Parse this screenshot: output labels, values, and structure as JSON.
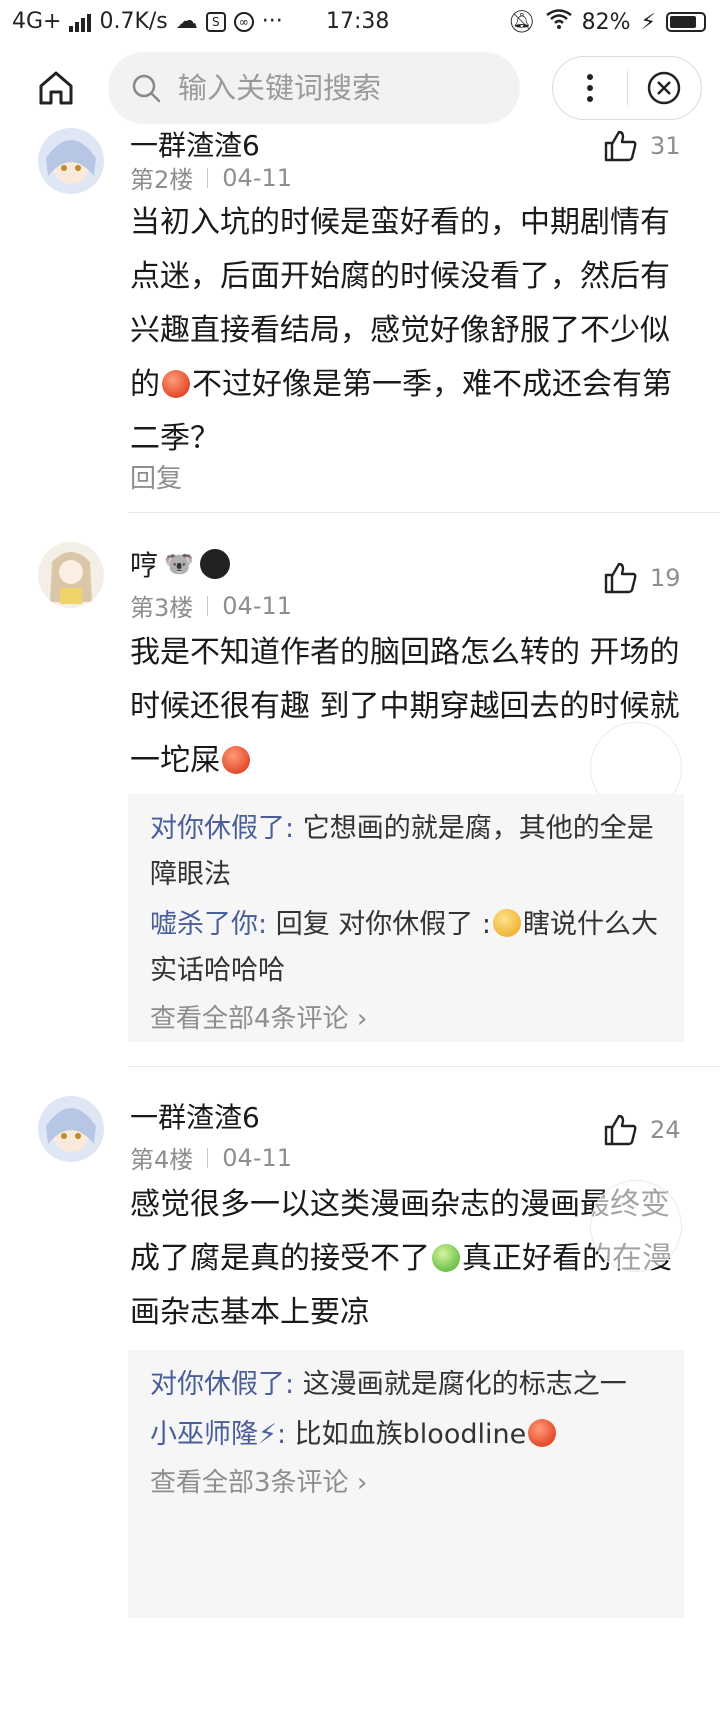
{
  "status_bar": {
    "network": "4G+",
    "speed": "0.7K/s",
    "time": "17:38",
    "more": "···",
    "battery": "82%",
    "battery_level": 0.82
  },
  "toolbar": {
    "search_placeholder": "输入关键词搜索"
  },
  "comments": [
    {
      "user": "一群渣渣6",
      "floor": "第2楼",
      "date": "04-11",
      "likes": "31",
      "text_a": "当初入坑的时候是蛮好看的，中期剧情有点迷，后面开始腐的时候没看了，然后有兴趣直接看结局，感觉好像舒服了不少似的",
      "text_b": "不过好像是第一季，难不成还会有第二季？",
      "reply_label": "回复"
    },
    {
      "user": "哼",
      "floor": "第3楼",
      "date": "04-11",
      "likes": "19",
      "text_a": "我是不知道作者的脑回路怎么转的 开场的时候还很有趣 到了中期穿越回去的时候就一坨屎",
      "replies": [
        {
          "who": "对你休假了:",
          "text": "它想画的就是腐，其他的全是障眼法"
        },
        {
          "who": "嘘杀了你:",
          "text_a": "回复 对你休假了 :",
          "text_b": "瞎说什么大实话哈哈哈"
        }
      ],
      "view_all": "查看全部4条评论"
    },
    {
      "user": "一群渣渣6",
      "floor": "第4楼",
      "date": "04-11",
      "likes": "24",
      "text_a": "感觉很多一以这类漫画杂志的漫画最终变成了腐是真的接受不了",
      "text_b": "真正好看的在漫画杂志基本上要凉",
      "replies": [
        {
          "who": "对你休假了:",
          "text": "这漫画就是腐化的标志之一"
        },
        {
          "who": "小巫师隆⚡:",
          "text": "比如血族bloodline"
        }
      ],
      "view_all": "查看全部3条评论"
    }
  ]
}
